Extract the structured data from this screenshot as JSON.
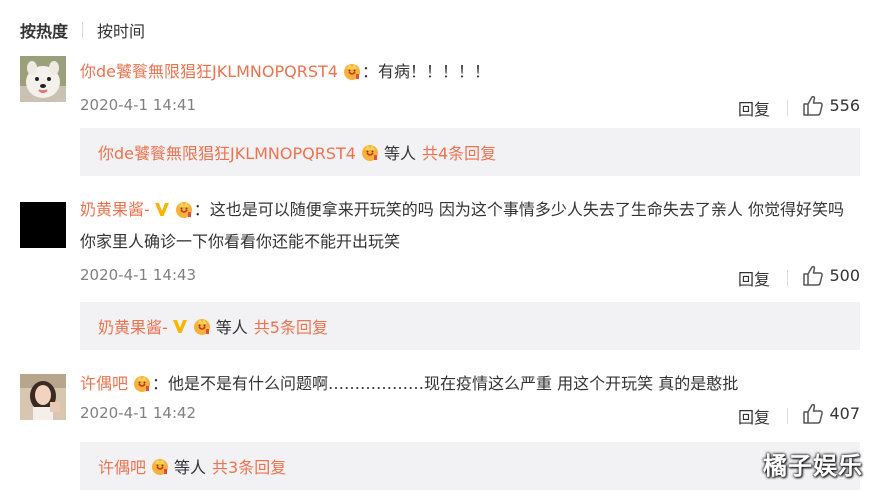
{
  "sort": {
    "active": "按热度",
    "other": "按时间"
  },
  "comments": [
    {
      "username": "你de饕餮無限猖狂JKLMNOPQRST4",
      "colon": "：",
      "text": "有病！！！！！",
      "time": "2020-4-1 14:41",
      "reply_label": "回复",
      "likes": "556",
      "reply_preview": {
        "name": "你de饕餮無限猖狂JKLMNOPQRST4",
        "etc": "等人",
        "count": "共4条回复"
      }
    },
    {
      "username": "奶黄果酱-",
      "colon": "：",
      "text": "这也是可以随便拿来开玩笑的吗 因为这个事情多少人失去了生命失去了亲人 你觉得好笑吗 你家里人确诊一下你看看你还能不能开出玩笑",
      "time": "2020-4-1 14:43",
      "reply_label": "回复",
      "likes": "500",
      "reply_preview": {
        "name": "奶黄果酱-",
        "etc": "等人",
        "count": "共5条回复"
      }
    },
    {
      "username": "许偶吧",
      "colon": "：",
      "text": "他是不是有什么问题啊………………现在疫情这么严重 用这个开玩笑 真的是憨批",
      "time": "2020-4-1 14:42",
      "reply_label": "回复",
      "likes": "407",
      "reply_preview": {
        "name": "许偶吧",
        "etc": "等人",
        "count": "共3条回复"
      }
    }
  ],
  "watermark": "橘子娱乐",
  "colors": {
    "username": "#eb7350",
    "reply_bg": "#f2f2f5",
    "text": "#333333",
    "meta": "#808080"
  }
}
